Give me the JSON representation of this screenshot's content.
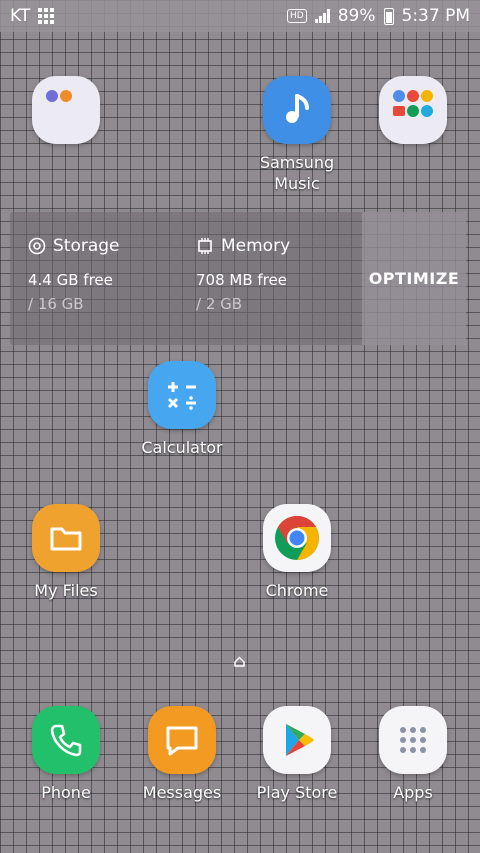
{
  "status_bar": {
    "carrier": "KT",
    "hd_badge": "HD",
    "battery_percent": "89%",
    "time": "5:37 PM"
  },
  "home": {
    "apps": [
      {
        "label": "Samsung\nMusic"
      },
      {
        "label": "Calculator"
      },
      {
        "label": "My Files"
      },
      {
        "label": "Chrome"
      }
    ]
  },
  "device_widget": {
    "storage": {
      "title": "Storage",
      "free": "4.4 GB free",
      "total": "/ 16 GB"
    },
    "memory": {
      "title": "Memory",
      "free": "708 MB free",
      "total": "/ 2 GB"
    },
    "optimize_label": "OPTIMIZE"
  },
  "dock": [
    {
      "label": "Phone"
    },
    {
      "label": "Messages"
    },
    {
      "label": "Play Store"
    },
    {
      "label": "Apps"
    }
  ],
  "colors": {
    "music": "#3f8fe6",
    "calculator": "#46a7f0",
    "myfiles": "#f0a22e",
    "phone": "#22c06a",
    "messages": "#f29a21",
    "chrome_red": "#db4437",
    "chrome_yellow": "#f4b400",
    "chrome_green": "#0f9d58",
    "chrome_blue": "#4285f4"
  }
}
